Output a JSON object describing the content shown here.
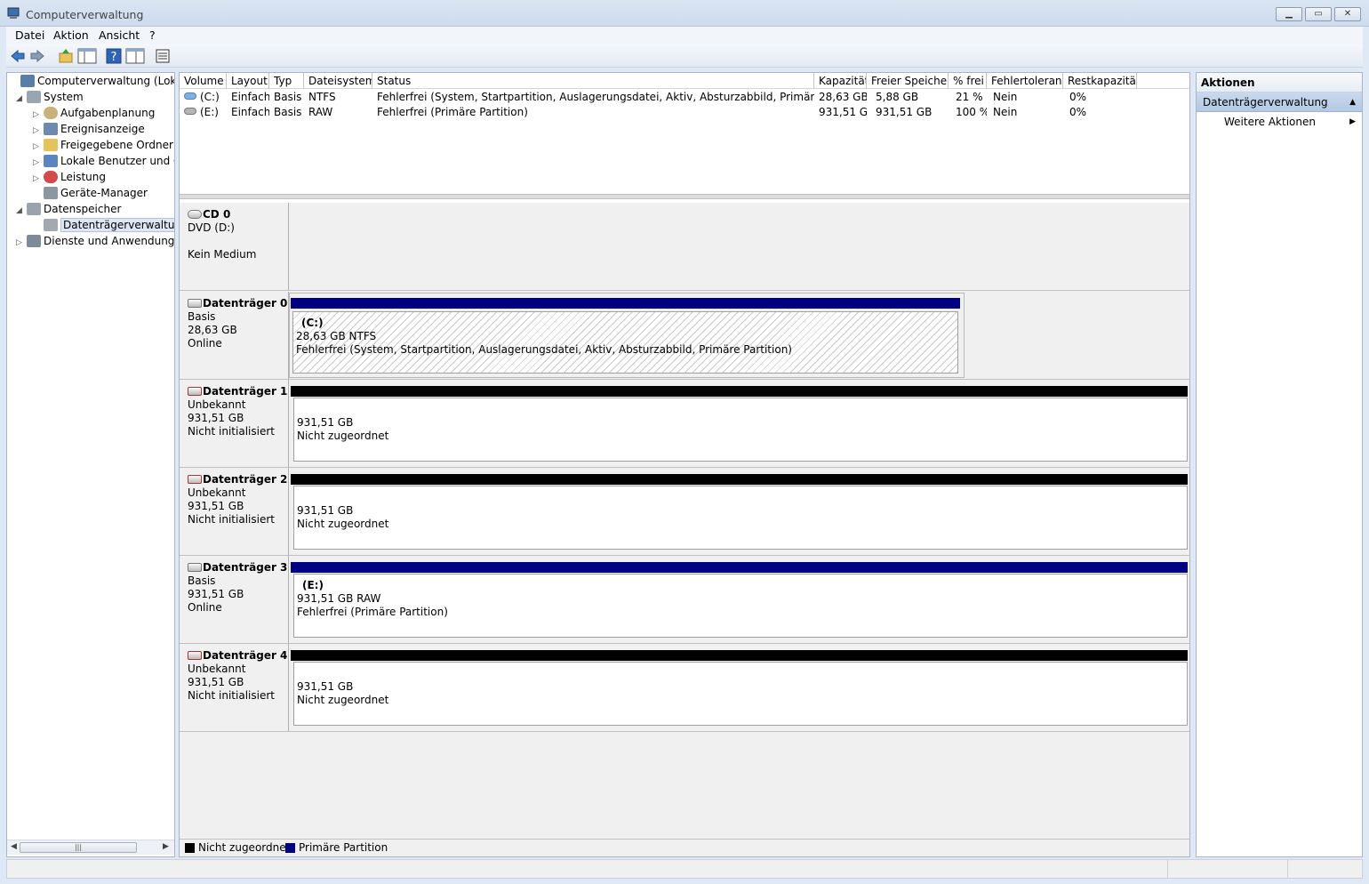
{
  "window": {
    "title": "Computerverwaltung",
    "min": "▁",
    "max": "▭",
    "close": "✕"
  },
  "menu": [
    "Datei",
    "Aktion",
    "Ansicht",
    "?"
  ],
  "toolbar": [
    "back-icon",
    "forward-icon",
    "up-folder-icon",
    "show-hide-tree-icon",
    "help-icon",
    "details-icon",
    "properties-icon"
  ],
  "tree": {
    "root": "Computerverwaltung (Lokal)",
    "system": "System",
    "aufgaben": "Aufgabenplanung",
    "ereignis": "Ereignisanzeige",
    "freigabe": "Freigegebene Ordner",
    "benutzer": "Lokale Benutzer und Gruppen",
    "leistung": "Leistung",
    "geraete": "Geräte-Manager",
    "datenspeicher": "Datenspeicher",
    "dtv": "Datenträgerverwaltung",
    "dienste": "Dienste und Anwendungen",
    "scroll_grip": "|||"
  },
  "volumes": {
    "headers": [
      "Volume",
      "Layout",
      "Typ",
      "Dateisystem",
      "Status",
      "Kapazität",
      "Freier Speicher",
      "% frei",
      "Fehlertoleranz",
      "Restkapazität"
    ],
    "rows": [
      [
        "(C:)",
        "Einfach",
        "Basis",
        "NTFS",
        "Fehlerfrei (System, Startpartition, Auslagerungsdatei, Aktiv, Absturzabbild, Primäre Partition)",
        "28,63 GB",
        "5,88 GB",
        "21 %",
        "Nein",
        "0%"
      ],
      [
        "(E:)",
        "Einfach",
        "Basis",
        "RAW",
        "Fehlerfrei (Primäre Partition)",
        "931,51 GB",
        "931,51 GB",
        "100 %",
        "Nein",
        "0%"
      ]
    ]
  },
  "disks": {
    "cd0": {
      "name": "CD 0",
      "l1": "DVD (D:)",
      "l2": "",
      "l3": "Kein Medium"
    },
    "d0": {
      "name": "Datenträger 0",
      "l1": "Basis",
      "l2": "28,63 GB",
      "l3": "Online",
      "part": {
        "name": "(C:)",
        "size": "28,63 GB NTFS",
        "status": "Fehlerfrei (System, Startpartition, Auslagerungsdatei, Aktiv, Absturzabbild, Primäre Partition)"
      }
    },
    "d1": {
      "name": "Datenträger 1",
      "l1": "Unbekannt",
      "l2": "931,51 GB",
      "l3": "Nicht initialisiert",
      "part": {
        "size": "931,51 GB",
        "status": "Nicht zugeordnet"
      }
    },
    "d2": {
      "name": "Datenträger 2",
      "l1": "Unbekannt",
      "l2": "931,51 GB",
      "l3": "Nicht initialisiert",
      "part": {
        "size": "931,51 GB",
        "status": "Nicht zugeordnet"
      }
    },
    "d3": {
      "name": "Datenträger 3",
      "l1": "Basis",
      "l2": "931,51 GB",
      "l3": "Online",
      "part": {
        "name": "(E:)",
        "size": "931,51 GB RAW",
        "status": "Fehlerfrei (Primäre Partition)"
      }
    },
    "d4": {
      "name": "Datenträger 4",
      "l1": "Unbekannt",
      "l2": "931,51 GB",
      "l3": "Nicht initialisiert",
      "part": {
        "size": "931,51 GB",
        "status": "Nicht zugeordnet"
      }
    }
  },
  "legend": {
    "unallocated": "Nicht zugeordnet",
    "primary": "Primäre Partition"
  },
  "colors": {
    "unallocated": "#000000",
    "primary": "#000080",
    "selection": "#dde6f2"
  },
  "actions": {
    "header": "Aktionen",
    "section": "Datenträgerverwaltung",
    "more": "Weitere Aktionen"
  }
}
